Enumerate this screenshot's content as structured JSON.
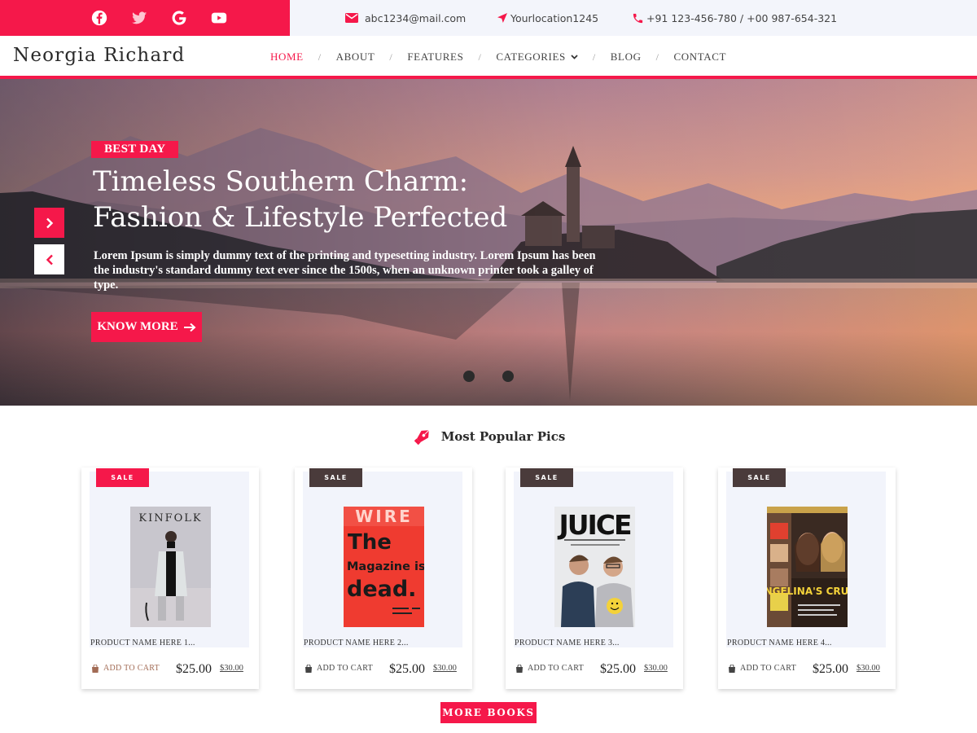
{
  "topbar": {
    "social": [
      "facebook-icon",
      "twitter-icon",
      "google-icon",
      "youtube-icon"
    ],
    "email": "abc1234@mail.com",
    "location": "Yourlocation1245",
    "phone": "+91 123-456-780 / +00 987-654-321"
  },
  "header": {
    "brand": "Neorgia Richard",
    "nav": [
      "HOME",
      "ABOUT",
      "FEATURES",
      "CATEGORIES",
      "BLOG",
      "CONTACT"
    ],
    "active": "HOME"
  },
  "hero": {
    "badge": "BEST DAY",
    "title_line1": "Timeless Southern Charm:",
    "title_line2": "Fashion & Lifestyle Perfected",
    "text": "Lorem Ipsum is simply dummy text of the printing and typesetting industry. Lorem Ipsum has been the industry's standard dummy text ever since the 1500s, when an unknown printer took a galley of type.",
    "button": "KNOW MORE"
  },
  "section": {
    "title": "Most Popular Pics"
  },
  "products": [
    {
      "sale": "SALE",
      "name": "PRODUCT NAME HERE 1...",
      "cart": "ADD TO CART",
      "price": "$25.00",
      "old_price": "$30.00",
      "cover_title": "KINFOLK",
      "sale_color": "#f5184a"
    },
    {
      "sale": "SALE",
      "name": "PRODUCT NAME HERE 2...",
      "cart": "ADD TO CART",
      "price": "$25.00",
      "old_price": "$30.00",
      "cover_title": "WIRE",
      "cover_lines": [
        "The",
        "Magazine is",
        "dead."
      ],
      "sale_color": "#4a3b3b"
    },
    {
      "sale": "SALE",
      "name": "PRODUCT NAME HERE 3...",
      "cart": "ADD TO CART",
      "price": "$25.00",
      "old_price": "$30.00",
      "cover_title": "JUICE",
      "sale_color": "#4a3b3b"
    },
    {
      "sale": "SALE",
      "name": "PRODUCT NAME HERE 4...",
      "cart": "ADD TO CART",
      "price": "$25.00",
      "old_price": "$30.00",
      "cover_title": "ANGELINA'S CRUEL LIE",
      "sale_color": "#4a3b3b"
    }
  ],
  "more_button": "MORE BOOKS",
  "colors": {
    "accent": "#f5184a",
    "dark_badge": "#4a3b3b",
    "topbar_bg": "#f3f5fb"
  }
}
